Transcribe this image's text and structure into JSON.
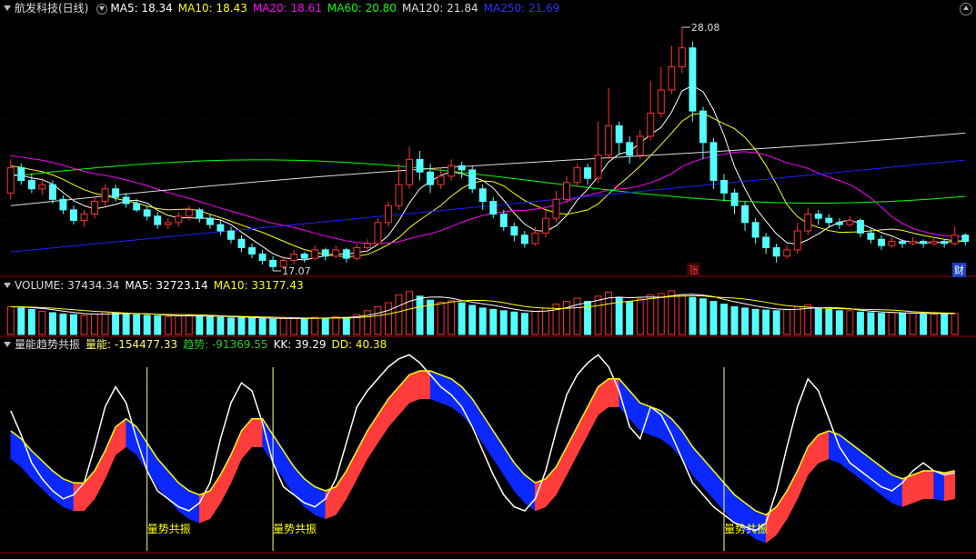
{
  "main_legend": {
    "stock": "航发科技(日线)",
    "ma5": "MA5: 18.34",
    "ma10": "MA10: 18.43",
    "ma20": "MA20: 18.61",
    "ma60": "MA60: 20.80",
    "ma120": "MA120: 21.84",
    "ma250": "MA250: 21.69"
  },
  "vol_legend": {
    "volume": "VOLUME: 37434.34",
    "ma5": "MA5: 32723.14",
    "ma10": "MA10: 33177.43"
  },
  "qn_legend": {
    "name": "量能趋势共振",
    "liangneng": "量能: -154477.33",
    "qushi": "趋势: -91369.55",
    "kk": "KK: 39.29",
    "dd": "DD: 40.38"
  },
  "annotations": {
    "high": "28.08",
    "low": "17.07",
    "zhang": "张",
    "cai": "财",
    "resonance": "量势共振"
  },
  "colors": {
    "up": "#ff3232",
    "down": "#54ffff",
    "ma5": "#ffffff",
    "ma10": "#ffff00",
    "ma20": "#ff00ff",
    "ma60": "#00ff00",
    "ma120": "#dddddd",
    "ma250": "#2020ff",
    "dd_red": "#ff3c3c",
    "dd_blue": "#0a28ff"
  },
  "chart_data": {
    "type": "candlestick",
    "price_range": [
      16.5,
      28.6
    ],
    "candles": [
      [
        20.2,
        21.4,
        21.8,
        19.9
      ],
      [
        21.4,
        20.8,
        21.6,
        20.6
      ],
      [
        20.8,
        20.4,
        21.1,
        20.2
      ],
      [
        20.4,
        20.6,
        20.9,
        20.1
      ],
      [
        20.6,
        19.9,
        20.8,
        19.7
      ],
      [
        19.9,
        19.4,
        20.1,
        19.2
      ],
      [
        19.4,
        18.9,
        19.6,
        18.7
      ],
      [
        18.9,
        19.2,
        19.4,
        18.6
      ],
      [
        19.2,
        19.8,
        20.0,
        19.0
      ],
      [
        19.8,
        20.4,
        20.6,
        19.6
      ],
      [
        20.4,
        20.0,
        20.6,
        19.8
      ],
      [
        20.0,
        19.7,
        20.2,
        19.5
      ],
      [
        19.7,
        19.4,
        19.9,
        19.3
      ],
      [
        19.4,
        19.1,
        19.6,
        18.9
      ],
      [
        19.1,
        18.7,
        19.3,
        18.5
      ],
      [
        18.7,
        18.8,
        19.0,
        18.5
      ],
      [
        18.8,
        19.1,
        19.3,
        18.6
      ],
      [
        19.1,
        19.4,
        19.6,
        18.9
      ],
      [
        19.4,
        19.0,
        19.5,
        18.8
      ],
      [
        19.0,
        18.7,
        19.2,
        18.5
      ],
      [
        18.7,
        18.4,
        18.9,
        18.2
      ],
      [
        18.4,
        18.0,
        18.6,
        17.8
      ],
      [
        18.0,
        17.6,
        18.2,
        17.4
      ],
      [
        17.6,
        17.3,
        17.8,
        17.1
      ],
      [
        17.3,
        17.0,
        17.5,
        16.8
      ],
      [
        17.0,
        16.7,
        17.2,
        16.5
      ],
      [
        16.7,
        17.0,
        17.2,
        16.6
      ],
      [
        17.0,
        17.3,
        17.5,
        16.8
      ],
      [
        17.3,
        17.1,
        17.4,
        16.9
      ],
      [
        17.1,
        17.5,
        17.7,
        17.0
      ],
      [
        17.5,
        17.2,
        17.6,
        17.0
      ],
      [
        17.2,
        17.5,
        17.7,
        17.1
      ],
      [
        17.5,
        17.1,
        17.6,
        16.9
      ],
      [
        17.1,
        17.6,
        17.8,
        17.0
      ],
      [
        17.6,
        17.8,
        18.0,
        17.4
      ],
      [
        17.8,
        18.8,
        19.0,
        17.7
      ],
      [
        18.8,
        19.6,
        19.8,
        18.6
      ],
      [
        19.6,
        20.6,
        21.6,
        19.4
      ],
      [
        20.6,
        21.8,
        22.4,
        20.4
      ],
      [
        21.8,
        21.2,
        22.2,
        20.8
      ],
      [
        21.2,
        20.6,
        21.6,
        20.2
      ],
      [
        20.6,
        21.0,
        21.4,
        20.4
      ],
      [
        21.0,
        21.5,
        21.8,
        20.8
      ],
      [
        21.5,
        21.3,
        21.7,
        20.9
      ],
      [
        21.3,
        20.4,
        21.5,
        20.2
      ],
      [
        20.4,
        19.8,
        20.6,
        19.4
      ],
      [
        19.8,
        19.2,
        20.0,
        19.0
      ],
      [
        19.2,
        18.6,
        19.4,
        18.4
      ],
      [
        18.6,
        18.2,
        18.8,
        17.9
      ],
      [
        18.2,
        17.8,
        18.4,
        17.6
      ],
      [
        17.8,
        18.3,
        18.6,
        17.7
      ],
      [
        18.3,
        19.0,
        19.4,
        18.1
      ],
      [
        19.0,
        19.9,
        20.3,
        18.8
      ],
      [
        19.9,
        20.7,
        21.0,
        19.7
      ],
      [
        20.7,
        21.4,
        21.6,
        20.5
      ],
      [
        21.4,
        20.9,
        21.6,
        20.6
      ],
      [
        20.9,
        22.0,
        23.6,
        20.7
      ],
      [
        22.0,
        23.4,
        25.2,
        21.8
      ],
      [
        23.4,
        22.6,
        23.6,
        22.0
      ],
      [
        22.6,
        22.0,
        22.9,
        21.6
      ],
      [
        22.0,
        22.9,
        23.2,
        21.8
      ],
      [
        22.9,
        24.0,
        25.5,
        22.7
      ],
      [
        24.0,
        25.1,
        26.2,
        23.8
      ],
      [
        25.1,
        26.2,
        27.2,
        24.9
      ],
      [
        26.2,
        27.1,
        28.08,
        25.9
      ],
      [
        27.1,
        24.1,
        27.4,
        23.6
      ],
      [
        24.1,
        22.6,
        24.3,
        21.8
      ],
      [
        22.6,
        20.8,
        22.8,
        20.4
      ],
      [
        20.8,
        20.2,
        21.1,
        19.8
      ],
      [
        20.2,
        19.6,
        20.4,
        19.2
      ],
      [
        19.6,
        18.8,
        19.8,
        18.4
      ],
      [
        18.8,
        18.1,
        19.0,
        17.8
      ],
      [
        18.1,
        17.6,
        18.3,
        17.3
      ],
      [
        17.6,
        17.2,
        17.8,
        16.9
      ],
      [
        17.2,
        17.5,
        17.7,
        17.07
      ],
      [
        17.5,
        18.4,
        18.8,
        17.3
      ],
      [
        18.4,
        19.2,
        19.5,
        18.2
      ],
      [
        19.2,
        19.0,
        19.4,
        18.7
      ],
      [
        19.0,
        18.8,
        19.2,
        18.6
      ],
      [
        18.8,
        18.7,
        19.0,
        18.5
      ],
      [
        18.7,
        18.9,
        19.1,
        18.6
      ],
      [
        18.9,
        18.3,
        19.0,
        18.1
      ],
      [
        18.3,
        18.0,
        18.5,
        17.8
      ],
      [
        18.0,
        17.7,
        18.2,
        17.5
      ],
      [
        17.7,
        17.9,
        18.1,
        17.6
      ],
      [
        17.9,
        17.8,
        18.0,
        17.6
      ],
      [
        17.8,
        17.9,
        18.1,
        17.7
      ],
      [
        17.9,
        17.8,
        18.0,
        17.6
      ],
      [
        17.8,
        17.9,
        18.1,
        17.7
      ],
      [
        17.9,
        17.8,
        18.0,
        17.6
      ],
      [
        17.8,
        18.2,
        18.6,
        17.7
      ],
      [
        18.2,
        17.9,
        18.3,
        17.7
      ]
    ],
    "volumes": [
      42000,
      40000,
      38000,
      35000,
      33000,
      31000,
      30000,
      29000,
      31000,
      34000,
      33000,
      31000,
      30000,
      29000,
      28000,
      27000,
      28000,
      29000,
      28000,
      27000,
      26000,
      25000,
      26000,
      25000,
      24000,
      23000,
      24000,
      25000,
      24000,
      26000,
      25000,
      27000,
      26000,
      30000,
      36000,
      42000,
      48000,
      60000,
      65000,
      58000,
      52000,
      49000,
      51000,
      48000,
      44000,
      40000,
      38000,
      36000,
      34000,
      32000,
      35000,
      40000,
      46000,
      50000,
      55000,
      50000,
      58000,
      64000,
      56000,
      50000,
      54000,
      60000,
      62000,
      66000,
      60000,
      56000,
      54000,
      50000,
      46000,
      42000,
      40000,
      38000,
      37000,
      36000,
      38000,
      42000,
      45000,
      40000,
      38000,
      36000,
      36000,
      34000,
      33000,
      32000,
      33000,
      32000,
      32000,
      31000,
      31000,
      32000,
      32000
    ],
    "indicator": {
      "kk": [
        70,
        58,
        44,
        36,
        30,
        26,
        28,
        34,
        52,
        72,
        82,
        74,
        56,
        40,
        30,
        26,
        22,
        20,
        24,
        34,
        56,
        74,
        84,
        80,
        64,
        44,
        32,
        28,
        24,
        22,
        26,
        36,
        54,
        72,
        80,
        86,
        92,
        96,
        98,
        94,
        88,
        82,
        78,
        72,
        62,
        50,
        38,
        28,
        22,
        20,
        26,
        40,
        60,
        78,
        88,
        94,
        98,
        92,
        80,
        62,
        56,
        72,
        68,
        58,
        46,
        34,
        28,
        22,
        18,
        14,
        12,
        10,
        14,
        30,
        52,
        72,
        86,
        80,
        66,
        52,
        44,
        40,
        36,
        32,
        30,
        34,
        40,
        44,
        40,
        38,
        39
      ],
      "dd": [
        60,
        56,
        50,
        45,
        40,
        36,
        34,
        34,
        40,
        50,
        62,
        66,
        62,
        54,
        46,
        40,
        34,
        30,
        28,
        30,
        38,
        48,
        60,
        66,
        66,
        58,
        50,
        42,
        36,
        32,
        30,
        32,
        40,
        50,
        60,
        68,
        76,
        82,
        88,
        90,
        90,
        88,
        86,
        82,
        76,
        68,
        60,
        52,
        44,
        38,
        34,
        36,
        42,
        52,
        62,
        72,
        82,
        86,
        86,
        80,
        74,
        72,
        70,
        66,
        60,
        52,
        46,
        40,
        34,
        28,
        24,
        20,
        18,
        22,
        30,
        40,
        52,
        58,
        60,
        58,
        54,
        50,
        46,
        42,
        38,
        36,
        38,
        40,
        40,
        39,
        40
      ]
    }
  }
}
